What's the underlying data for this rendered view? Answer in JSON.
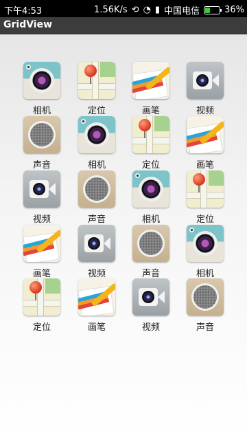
{
  "status_bar": {
    "time": "下午4:53",
    "speed": "1.56K/s",
    "carrier": "中国电信",
    "battery": "36%",
    "battery_level": 0.36
  },
  "app_bar": {
    "title": "GridView"
  },
  "grid": {
    "items": [
      {
        "label": "相机",
        "icon": "camera-icon"
      },
      {
        "label": "定位",
        "icon": "location-map-icon"
      },
      {
        "label": "画笔",
        "icon": "pencil-paint-icon"
      },
      {
        "label": "视频",
        "icon": "video-camera-icon"
      },
      {
        "label": "声音",
        "icon": "speaker-icon"
      },
      {
        "label": "相机",
        "icon": "camera-icon"
      },
      {
        "label": "定位",
        "icon": "location-map-icon"
      },
      {
        "label": "画笔",
        "icon": "pencil-paint-icon"
      },
      {
        "label": "视频",
        "icon": "video-camera-icon"
      },
      {
        "label": "声音",
        "icon": "speaker-icon"
      },
      {
        "label": "相机",
        "icon": "camera-icon"
      },
      {
        "label": "定位",
        "icon": "location-map-icon"
      },
      {
        "label": "画笔",
        "icon": "pencil-paint-icon"
      },
      {
        "label": "视频",
        "icon": "video-camera-icon"
      },
      {
        "label": "声音",
        "icon": "speaker-icon"
      },
      {
        "label": "相机",
        "icon": "camera-icon"
      },
      {
        "label": "定位",
        "icon": "location-map-icon"
      },
      {
        "label": "画笔",
        "icon": "pencil-paint-icon"
      },
      {
        "label": "视频",
        "icon": "video-camera-icon"
      },
      {
        "label": "声音",
        "icon": "speaker-icon"
      }
    ]
  }
}
